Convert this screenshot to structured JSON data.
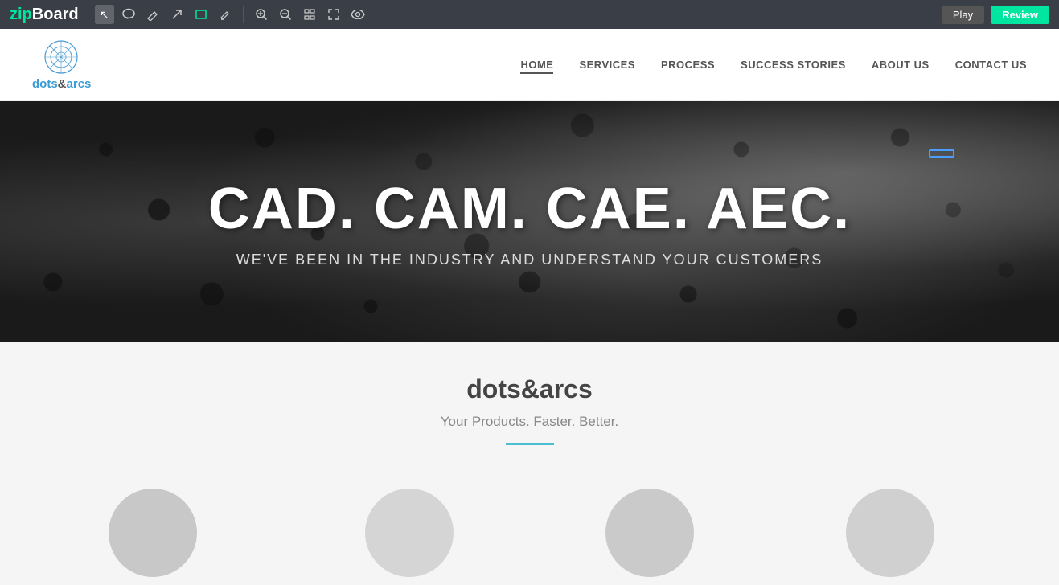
{
  "toolbar": {
    "logo_zip": "zip",
    "logo_board": "Board",
    "btn_play": "Play",
    "btn_review": "Review",
    "tools": [
      {
        "name": "cursor-icon",
        "symbol": "↖",
        "active": true
      },
      {
        "name": "comment-icon",
        "symbol": "💬"
      },
      {
        "name": "pen-icon",
        "symbol": "✎"
      },
      {
        "name": "arrow-icon",
        "symbol": "↗"
      },
      {
        "name": "rectangle-icon",
        "symbol": "⬜"
      },
      {
        "name": "highlighter-icon",
        "symbol": "✏"
      },
      {
        "name": "zoom-in-icon",
        "symbol": "⊕"
      },
      {
        "name": "zoom-out-icon",
        "symbol": "⊖"
      },
      {
        "name": "grid-icon",
        "symbol": "⊞"
      },
      {
        "name": "fullscreen-icon",
        "symbol": "⤢"
      },
      {
        "name": "preview-icon",
        "symbol": "👁"
      }
    ]
  },
  "nav": {
    "logo_text": "dots&arcs",
    "links": [
      {
        "label": "HOME",
        "active": true
      },
      {
        "label": "SERVICES",
        "active": false
      },
      {
        "label": "PROCESS",
        "active": false
      },
      {
        "label": "SUCCESS STORIES",
        "active": false
      },
      {
        "label": "ABOUT US",
        "active": false
      },
      {
        "label": "CONTACT US",
        "active": false
      }
    ]
  },
  "hero": {
    "title": "CAD. CAM. CAE. AEC.",
    "subtitle": "WE'VE BEEN IN THE INDUSTRY AND UNDERSTAND YOUR CUSTOMERS"
  },
  "content": {
    "heading": "dots&arcs",
    "subtext": "Your Products. Faster. Better."
  }
}
